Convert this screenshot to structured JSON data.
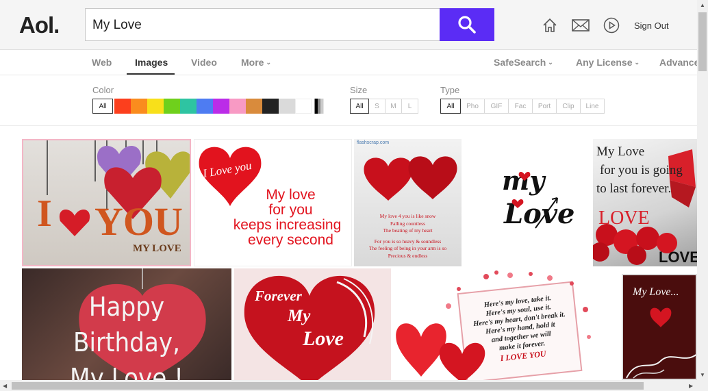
{
  "header": {
    "logo": "Aol.",
    "search_value": "My Love",
    "sign_out": "Sign Out"
  },
  "tabs": [
    {
      "label": "Web"
    },
    {
      "label": "Images"
    },
    {
      "label": "Video"
    },
    {
      "label": "More"
    }
  ],
  "tools": {
    "safesearch": "SafeSearch",
    "license": "Any License",
    "advanced": "Advance"
  },
  "filters": {
    "color_label": "Color",
    "color_all": "All",
    "colors": [
      "#fc3f1d",
      "#fa8c1e",
      "#f8e01a",
      "#6fd01c",
      "#2ec4a2",
      "#4e7cf2",
      "#bb2ce8",
      "#f89ac4",
      "#d98b3c",
      "#222222",
      "#dadada",
      "#ffffff"
    ],
    "size_label": "Size",
    "sizes": [
      "All",
      "S",
      "M",
      "L"
    ],
    "type_label": "Type",
    "types": [
      "All",
      "Pho",
      "GIF",
      "Fac",
      "Port",
      "Clip",
      "Line"
    ]
  },
  "images": {
    "img1": {
      "line1": "I",
      "line2": "YOU",
      "caption": "MY LOVE"
    },
    "img2": {
      "bubble": "I Love you",
      "l1": "My love",
      "l2": "for you",
      "l3": "keeps increasing",
      "l4": "every second"
    },
    "img3": {
      "site": "flashscrap.com",
      "t1": "My love 4 you is like snow",
      "t2": "Falling countless",
      "t3": "The beating of my heart",
      "t4": "For you is so heavy & soundless",
      "t5": "The feeling of being in your arm is so",
      "t6": "Precious & endless"
    },
    "img4": {
      "l1": "my",
      "l2": "Love"
    },
    "img5": {
      "l1": "My Love",
      "l2": "for you is going",
      "l3": "to last forever.",
      "l4": "LOVE",
      "l5": "LOVE"
    },
    "img6": {
      "l1": "Happy Birthday,",
      "l2": "My Love !"
    },
    "img7": {
      "l1": "Forever",
      "l2": "My",
      "l3": "Love"
    },
    "img8": {
      "l1": "Here's my love, take it.",
      "l2": "Here's my soul, use it.",
      "l3": "Here's my heart, don't break it.",
      "l4": "Here's my hand, hold it",
      "l5": "and together we will",
      "l6": "make it forever.",
      "l7": "I LOVE YOU"
    },
    "img9": {
      "l1": "My Love..."
    }
  }
}
